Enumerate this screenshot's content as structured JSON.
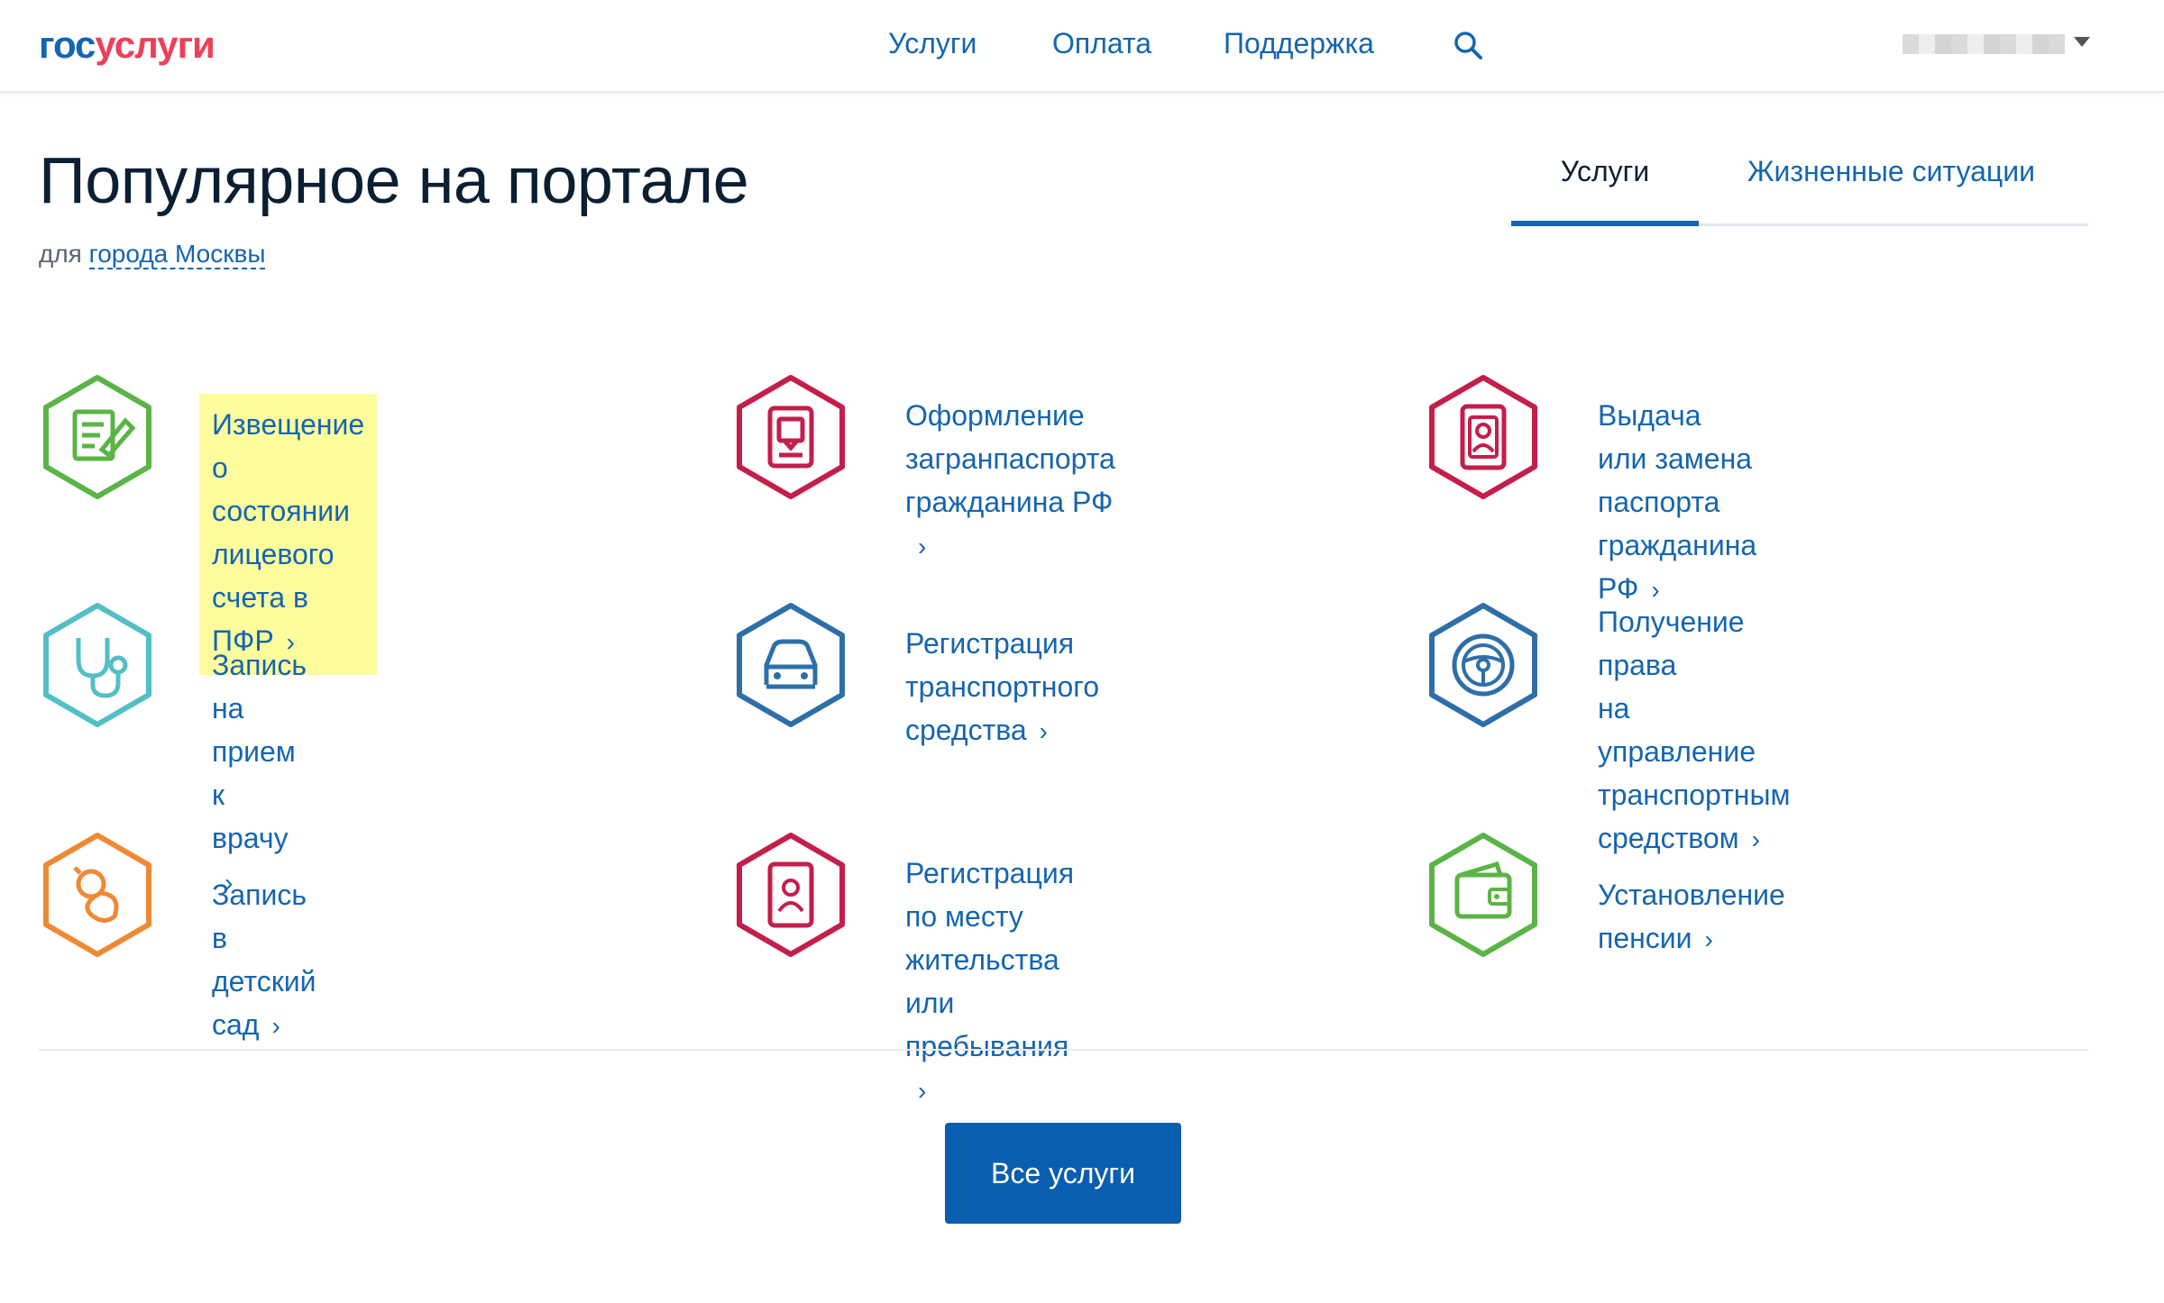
{
  "header": {
    "logo_part1": "гос",
    "logo_part2": "услуги",
    "nav": [
      "Услуги",
      "Оплата",
      "Поддержка"
    ],
    "search_icon": "search-icon"
  },
  "main": {
    "title": "Популярное на портале",
    "region_prefix": "для",
    "region_link": "города Москвы"
  },
  "tabs": [
    "Услуги",
    "Жизненные ситуации"
  ],
  "services": [
    {
      "icon": "document-edit-icon",
      "color": "#5bb446",
      "lines": [
        "Извещение о состоянии",
        "лицевого счета в ПФР"
      ],
      "highlighted": true
    },
    {
      "icon": "passport-icon",
      "color": "#c41e4b",
      "lines": [
        "Оформление загранпаспорта",
        "гражданина РФ"
      ]
    },
    {
      "icon": "id-card-icon",
      "color": "#c41e4b",
      "lines": [
        "Выдача или замена паспорта",
        "гражданина РФ"
      ]
    },
    {
      "icon": "stethoscope-icon",
      "color": "#52bfc6",
      "lines": [
        "Запись на прием к врачу"
      ]
    },
    {
      "icon": "car-icon",
      "color": "#2e6fa7",
      "lines": [
        "Регистрация транспортного",
        "средства"
      ]
    },
    {
      "icon": "steering-wheel-icon",
      "color": "#2e6fa7",
      "lines": [
        "Получение права",
        "на управление транспортным",
        "средством"
      ]
    },
    {
      "icon": "pacifier-icon",
      "color": "#ee8a34",
      "lines": [
        "Запись в детский сад"
      ]
    },
    {
      "icon": "registration-passport-icon",
      "color": "#c41e4b",
      "lines": [
        "Регистрация по месту",
        "жительства или пребывания"
      ]
    },
    {
      "icon": "wallet-icon",
      "color": "#5bb446",
      "lines": [
        "Установление пенсии"
      ]
    }
  ],
  "all_services_button": "Все услуги",
  "colors": {
    "link": "#1565b0",
    "button": "#0a5eb0",
    "highlight": "#fdfd9e"
  }
}
